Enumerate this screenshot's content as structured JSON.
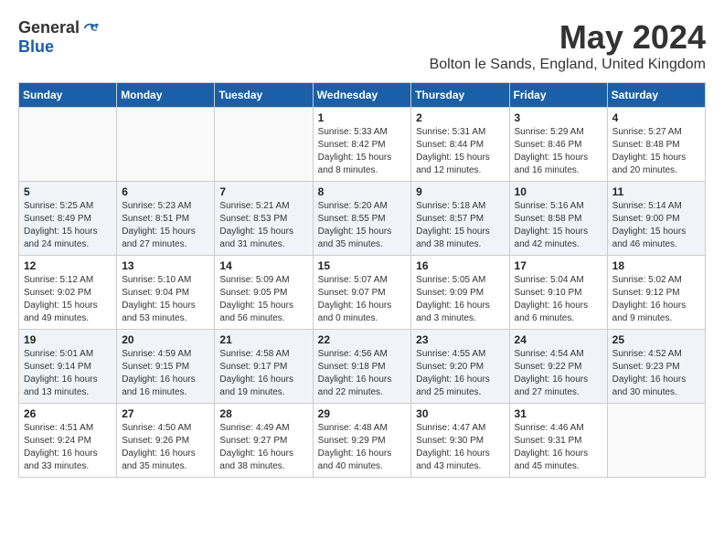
{
  "header": {
    "logo_general": "General",
    "logo_blue": "Blue",
    "month_year": "May 2024",
    "location": "Bolton le Sands, England, United Kingdom"
  },
  "days_of_week": [
    "Sunday",
    "Monday",
    "Tuesday",
    "Wednesday",
    "Thursday",
    "Friday",
    "Saturday"
  ],
  "weeks": [
    {
      "days": [
        {
          "number": "",
          "info": ""
        },
        {
          "number": "",
          "info": ""
        },
        {
          "number": "",
          "info": ""
        },
        {
          "number": "1",
          "info": "Sunrise: 5:33 AM\nSunset: 8:42 PM\nDaylight: 15 hours\nand 8 minutes."
        },
        {
          "number": "2",
          "info": "Sunrise: 5:31 AM\nSunset: 8:44 PM\nDaylight: 15 hours\nand 12 minutes."
        },
        {
          "number": "3",
          "info": "Sunrise: 5:29 AM\nSunset: 8:46 PM\nDaylight: 15 hours\nand 16 minutes."
        },
        {
          "number": "4",
          "info": "Sunrise: 5:27 AM\nSunset: 8:48 PM\nDaylight: 15 hours\nand 20 minutes."
        }
      ]
    },
    {
      "days": [
        {
          "number": "5",
          "info": "Sunrise: 5:25 AM\nSunset: 8:49 PM\nDaylight: 15 hours\nand 24 minutes."
        },
        {
          "number": "6",
          "info": "Sunrise: 5:23 AM\nSunset: 8:51 PM\nDaylight: 15 hours\nand 27 minutes."
        },
        {
          "number": "7",
          "info": "Sunrise: 5:21 AM\nSunset: 8:53 PM\nDaylight: 15 hours\nand 31 minutes."
        },
        {
          "number": "8",
          "info": "Sunrise: 5:20 AM\nSunset: 8:55 PM\nDaylight: 15 hours\nand 35 minutes."
        },
        {
          "number": "9",
          "info": "Sunrise: 5:18 AM\nSunset: 8:57 PM\nDaylight: 15 hours\nand 38 minutes."
        },
        {
          "number": "10",
          "info": "Sunrise: 5:16 AM\nSunset: 8:58 PM\nDaylight: 15 hours\nand 42 minutes."
        },
        {
          "number": "11",
          "info": "Sunrise: 5:14 AM\nSunset: 9:00 PM\nDaylight: 15 hours\nand 46 minutes."
        }
      ]
    },
    {
      "days": [
        {
          "number": "12",
          "info": "Sunrise: 5:12 AM\nSunset: 9:02 PM\nDaylight: 15 hours\nand 49 minutes."
        },
        {
          "number": "13",
          "info": "Sunrise: 5:10 AM\nSunset: 9:04 PM\nDaylight: 15 hours\nand 53 minutes."
        },
        {
          "number": "14",
          "info": "Sunrise: 5:09 AM\nSunset: 9:05 PM\nDaylight: 15 hours\nand 56 minutes."
        },
        {
          "number": "15",
          "info": "Sunrise: 5:07 AM\nSunset: 9:07 PM\nDaylight: 16 hours\nand 0 minutes."
        },
        {
          "number": "16",
          "info": "Sunrise: 5:05 AM\nSunset: 9:09 PM\nDaylight: 16 hours\nand 3 minutes."
        },
        {
          "number": "17",
          "info": "Sunrise: 5:04 AM\nSunset: 9:10 PM\nDaylight: 16 hours\nand 6 minutes."
        },
        {
          "number": "18",
          "info": "Sunrise: 5:02 AM\nSunset: 9:12 PM\nDaylight: 16 hours\nand 9 minutes."
        }
      ]
    },
    {
      "days": [
        {
          "number": "19",
          "info": "Sunrise: 5:01 AM\nSunset: 9:14 PM\nDaylight: 16 hours\nand 13 minutes."
        },
        {
          "number": "20",
          "info": "Sunrise: 4:59 AM\nSunset: 9:15 PM\nDaylight: 16 hours\nand 16 minutes."
        },
        {
          "number": "21",
          "info": "Sunrise: 4:58 AM\nSunset: 9:17 PM\nDaylight: 16 hours\nand 19 minutes."
        },
        {
          "number": "22",
          "info": "Sunrise: 4:56 AM\nSunset: 9:18 PM\nDaylight: 16 hours\nand 22 minutes."
        },
        {
          "number": "23",
          "info": "Sunrise: 4:55 AM\nSunset: 9:20 PM\nDaylight: 16 hours\nand 25 minutes."
        },
        {
          "number": "24",
          "info": "Sunrise: 4:54 AM\nSunset: 9:22 PM\nDaylight: 16 hours\nand 27 minutes."
        },
        {
          "number": "25",
          "info": "Sunrise: 4:52 AM\nSunset: 9:23 PM\nDaylight: 16 hours\nand 30 minutes."
        }
      ]
    },
    {
      "days": [
        {
          "number": "26",
          "info": "Sunrise: 4:51 AM\nSunset: 9:24 PM\nDaylight: 16 hours\nand 33 minutes."
        },
        {
          "number": "27",
          "info": "Sunrise: 4:50 AM\nSunset: 9:26 PM\nDaylight: 16 hours\nand 35 minutes."
        },
        {
          "number": "28",
          "info": "Sunrise: 4:49 AM\nSunset: 9:27 PM\nDaylight: 16 hours\nand 38 minutes."
        },
        {
          "number": "29",
          "info": "Sunrise: 4:48 AM\nSunset: 9:29 PM\nDaylight: 16 hours\nand 40 minutes."
        },
        {
          "number": "30",
          "info": "Sunrise: 4:47 AM\nSunset: 9:30 PM\nDaylight: 16 hours\nand 43 minutes."
        },
        {
          "number": "31",
          "info": "Sunrise: 4:46 AM\nSunset: 9:31 PM\nDaylight: 16 hours\nand 45 minutes."
        },
        {
          "number": "",
          "info": ""
        }
      ]
    }
  ]
}
